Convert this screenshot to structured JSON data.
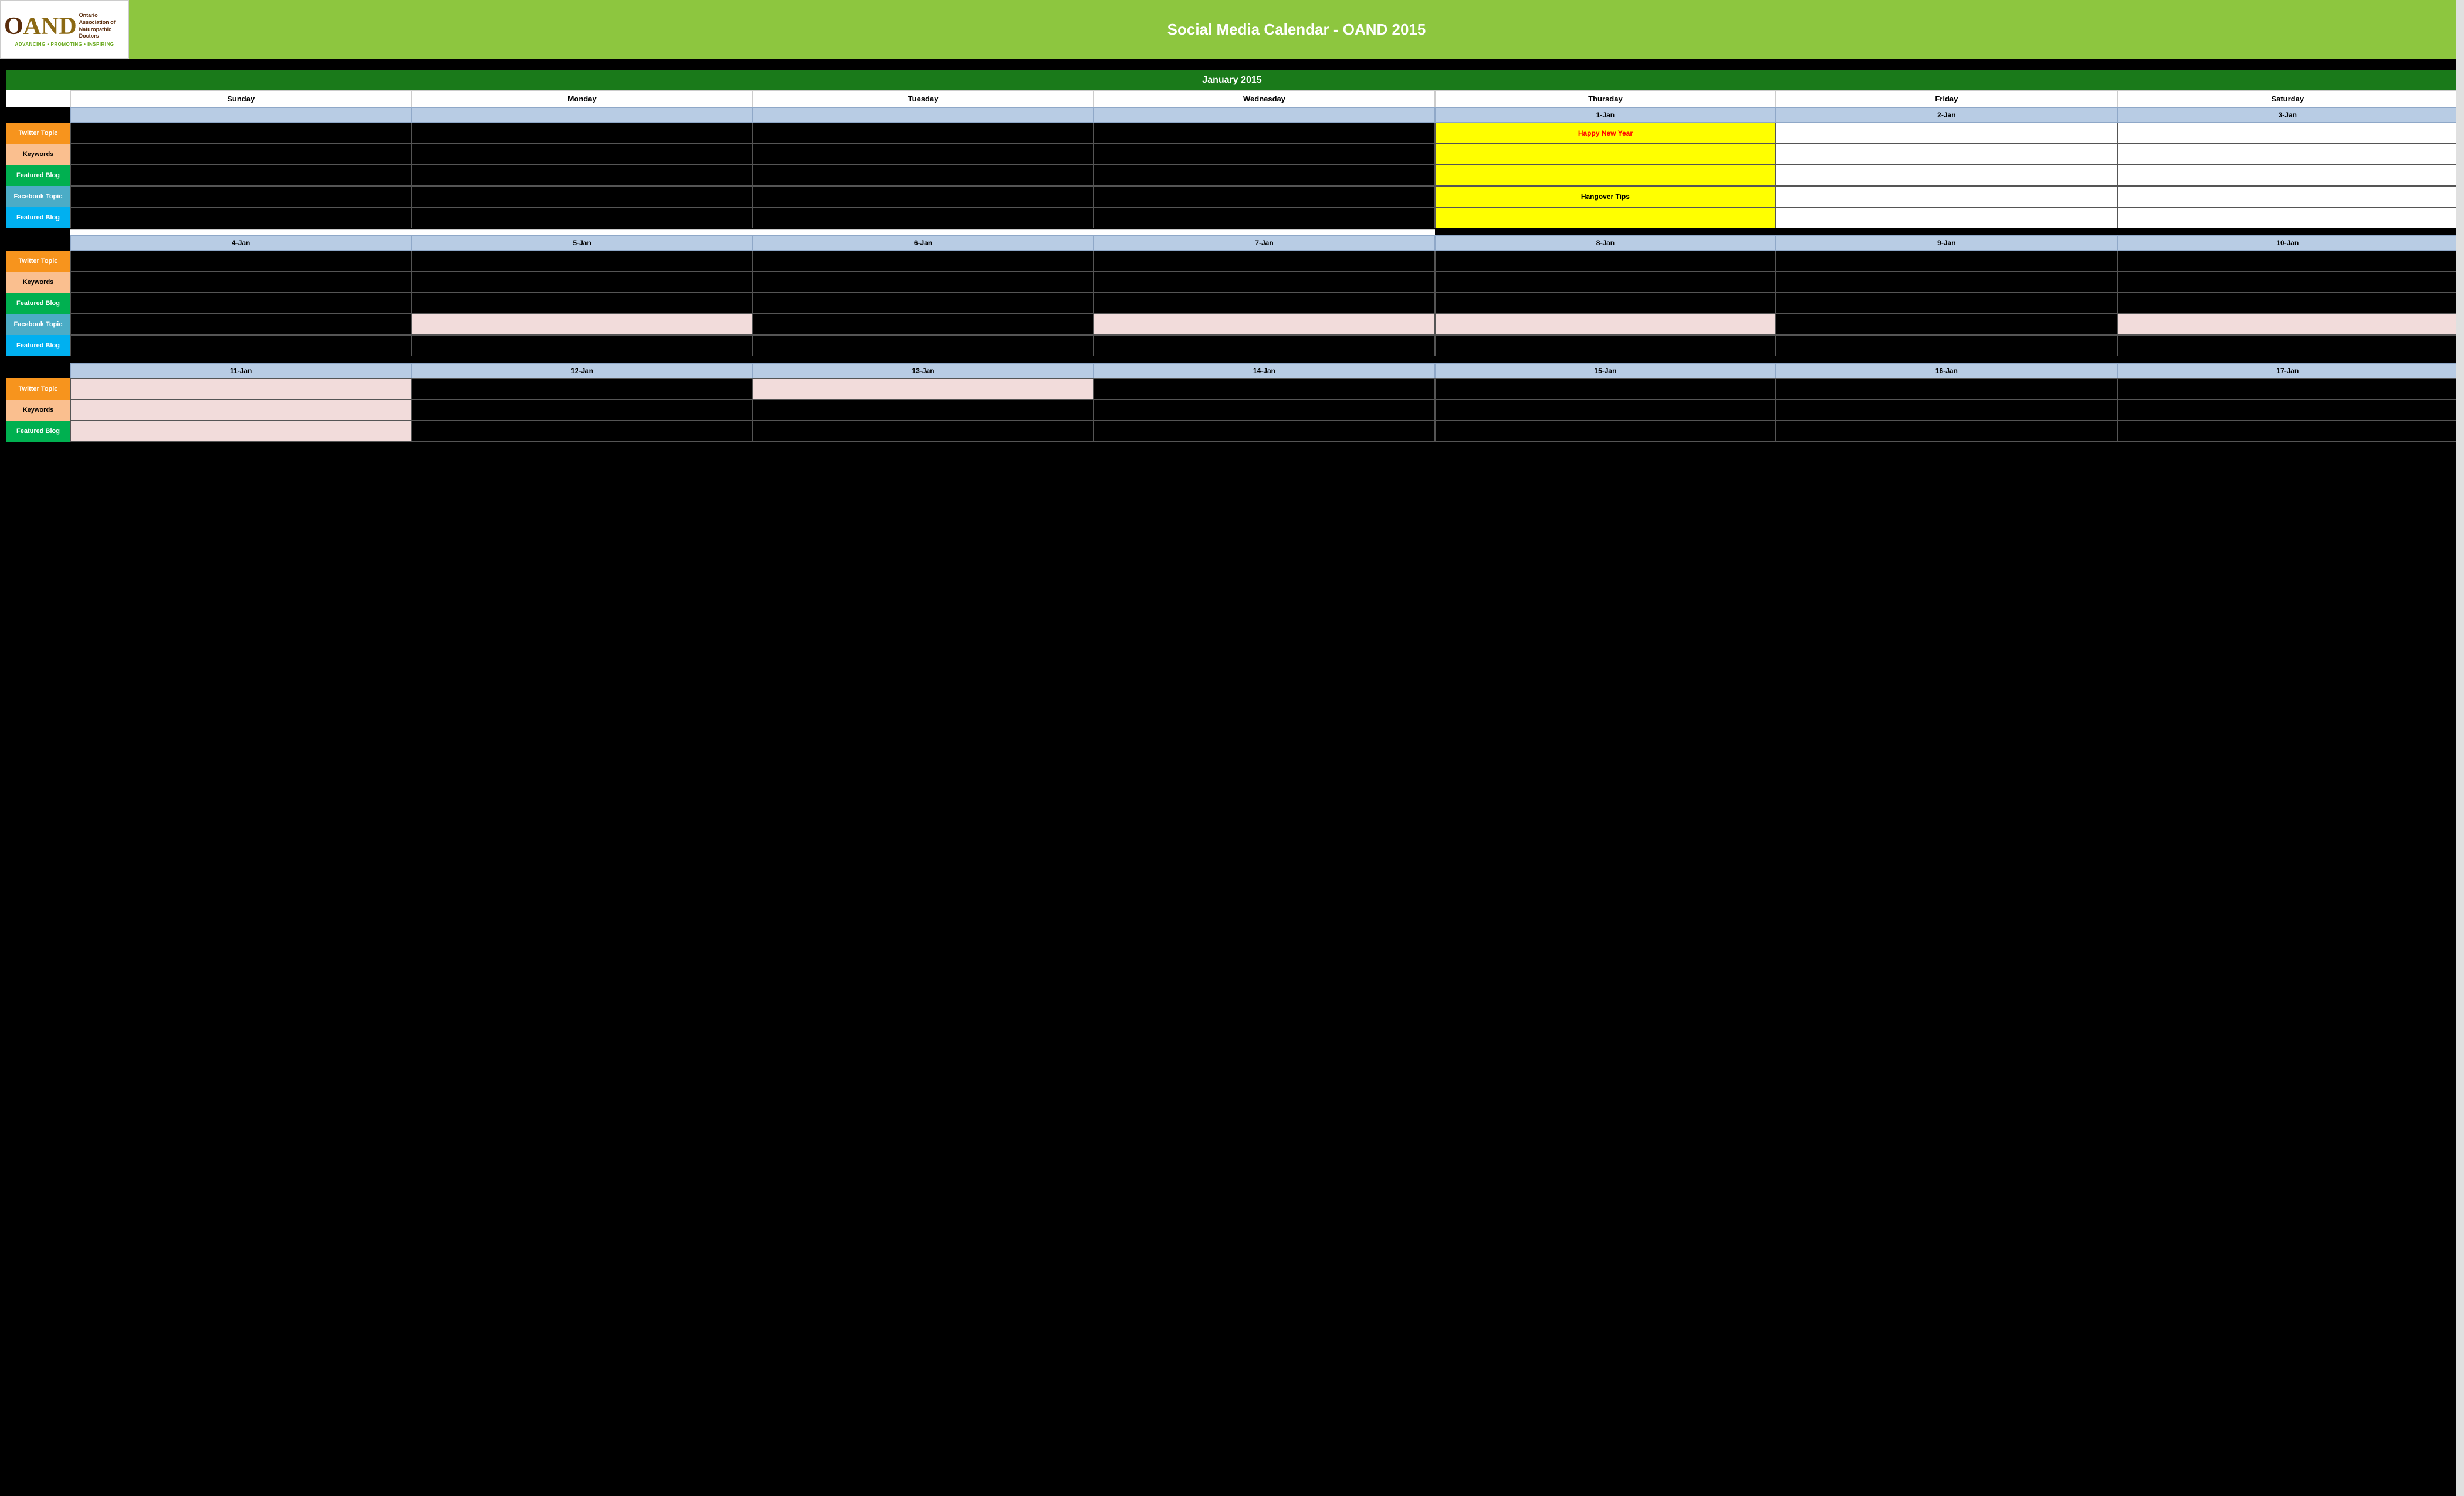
{
  "header": {
    "title": "Social Media Calendar - OAND 2015",
    "logo": {
      "org_name": "Ontario Association of Naturopathic Doctors",
      "tagline": "ADVANCING • PROMOTING • INSPIRING"
    }
  },
  "calendar": {
    "month_label": "January 2015",
    "day_headers": [
      "Sunday",
      "Monday",
      "Tuesday",
      "Wednesday",
      "Thursday",
      "Friday",
      "Saturday"
    ],
    "weeks": [
      {
        "dates": [
          "",
          "",
          "",
          "",
          "1-Jan",
          "2-Jan",
          "3-Jan"
        ],
        "rows": [
          {
            "label": "Twitter Topic",
            "label_type": "twitter",
            "cells": [
              "black",
              "black",
              "black",
              "black",
              "yellow-text:Happy New Year",
              "white",
              "white"
            ]
          },
          {
            "label": "Keywords",
            "label_type": "keywords",
            "cells": [
              "black",
              "black",
              "black",
              "black",
              "yellow",
              "white",
              "white"
            ]
          },
          {
            "label": "Featured Blog",
            "label_type": "featured-blog",
            "cells": [
              "black",
              "black",
              "black",
              "black",
              "yellow",
              "white",
              "white"
            ]
          },
          {
            "label": "Facebook Topic",
            "label_type": "facebook-topic",
            "cells": [
              "black",
              "black",
              "black",
              "black",
              "yellow-hangover:Hangover Tips",
              "white",
              "white"
            ]
          },
          {
            "label": "Featured Blog",
            "label_type": "featured-blog-blue",
            "cells": [
              "black",
              "black",
              "black",
              "black",
              "yellow",
              "white",
              "white"
            ]
          }
        ]
      },
      {
        "dates": [
          "4-Jan",
          "5-Jan",
          "6-Jan",
          "7-Jan",
          "8-Jan",
          "9-Jan",
          "10-Jan"
        ],
        "rows": [
          {
            "label": "Twitter Topic",
            "label_type": "twitter",
            "cells": [
              "black",
              "black",
              "black",
              "black",
              "black",
              "black",
              "black"
            ]
          },
          {
            "label": "Keywords",
            "label_type": "keywords",
            "cells": [
              "black",
              "black",
              "black",
              "black",
              "black",
              "black",
              "black"
            ]
          },
          {
            "label": "Featured Blog",
            "label_type": "featured-blog",
            "cells": [
              "black",
              "black",
              "black",
              "black",
              "black",
              "black",
              "black"
            ]
          },
          {
            "label": "Facebook Topic",
            "label_type": "facebook-topic",
            "cells": [
              "black",
              "pink",
              "black",
              "pink",
              "pink",
              "black",
              "pink"
            ]
          },
          {
            "label": "Featured Blog",
            "label_type": "featured-blog-blue",
            "cells": [
              "black",
              "black",
              "black",
              "black",
              "black",
              "black",
              "black"
            ]
          }
        ]
      },
      {
        "dates": [
          "11-Jan",
          "12-Jan",
          "13-Jan",
          "14-Jan",
          "15-Jan",
          "16-Jan",
          "17-Jan"
        ],
        "rows": [
          {
            "label": "Twitter Topic",
            "label_type": "twitter",
            "cells": [
              "pink",
              "black",
              "pink",
              "black",
              "black",
              "black",
              "black"
            ]
          },
          {
            "label": "Keywords",
            "label_type": "keywords",
            "cells": [
              "pink",
              "black",
              "black",
              "black",
              "black",
              "black",
              "black"
            ]
          },
          {
            "label": "Featured Blog",
            "label_type": "featured-blog",
            "cells": [
              "pink",
              "black",
              "black",
              "black",
              "black",
              "black",
              "black"
            ]
          }
        ]
      }
    ]
  }
}
